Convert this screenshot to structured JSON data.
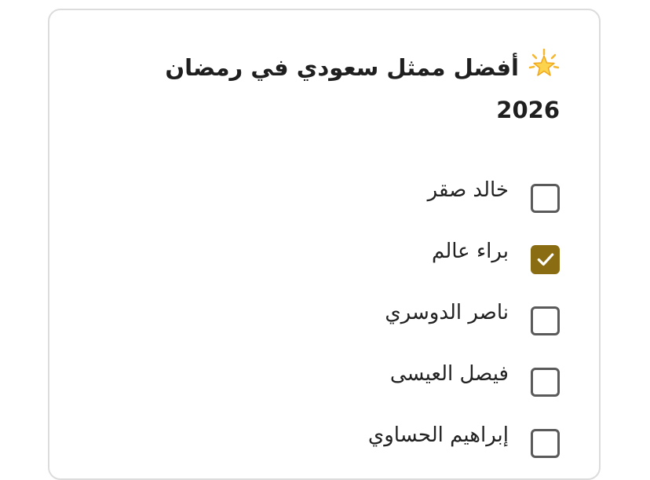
{
  "poll": {
    "title": "أفضل ممثل سعودي في رمضان",
    "year": "2026",
    "accent_color": "#8a6d12",
    "options": [
      {
        "label": "خالد صقر",
        "checked": false
      },
      {
        "label": "براء عالم",
        "checked": true
      },
      {
        "label": "ناصر الدوسري",
        "checked": false
      },
      {
        "label": "فيصل العيسى",
        "checked": false
      },
      {
        "label": "إبراهيم الحساوي",
        "checked": false
      }
    ]
  }
}
